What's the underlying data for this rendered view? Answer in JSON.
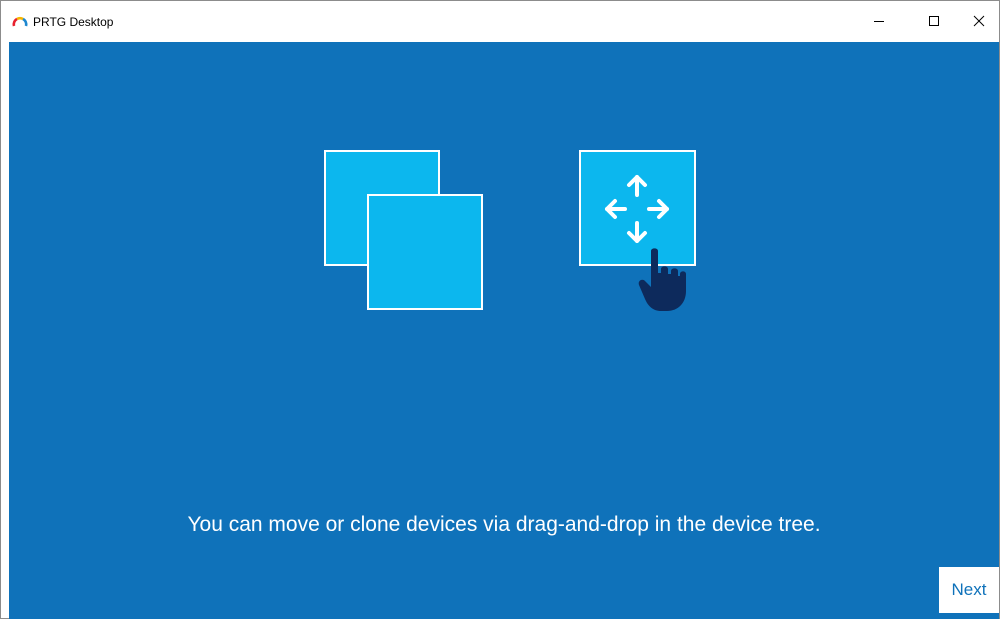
{
  "window": {
    "title": "PRTG Desktop",
    "app_icon": "prtg-gauge-icon",
    "controls": {
      "minimize_icon": "minimize-icon",
      "maximize_icon": "maximize-icon",
      "close_icon": "close-icon"
    }
  },
  "main": {
    "background_color": "#0f72ba",
    "illustration": {
      "tile_color": "#0cb7ee",
      "clone_icon": "stacked-squares-icon",
      "move_icon": "move-arrows-icon",
      "pointer_icon": "hand-pointer-icon",
      "pointer_color": "#0d2a5c"
    },
    "message": "You can move or clone devices via drag-and-drop in the device tree.",
    "next_label": "Next"
  }
}
